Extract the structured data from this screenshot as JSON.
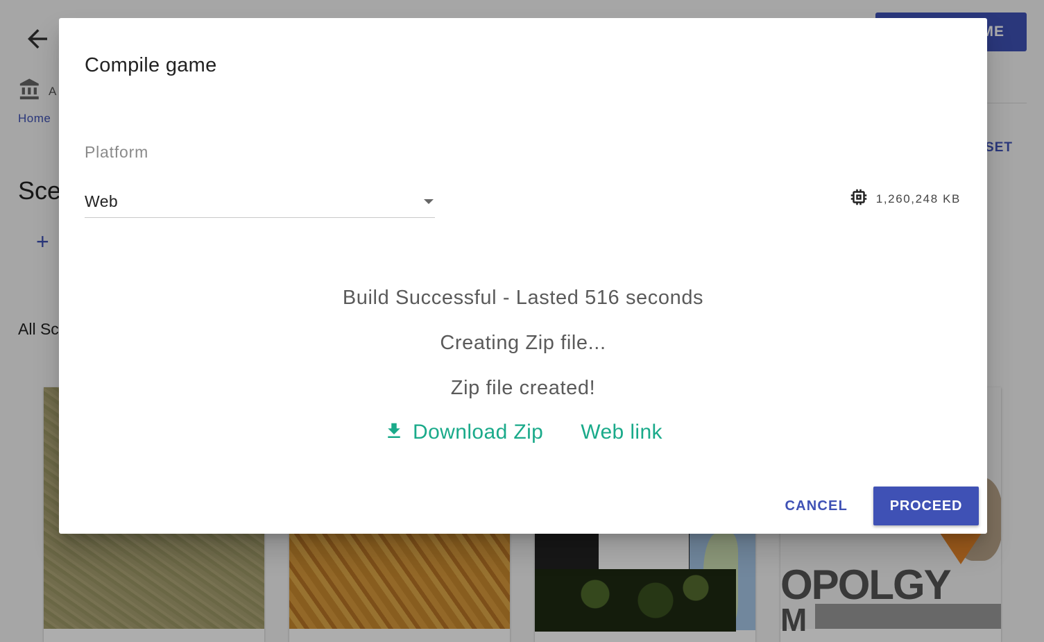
{
  "background": {
    "top_action_label": "ME",
    "project_label": "A",
    "breadcrumb": "Home",
    "reset_label": "SET",
    "section_title": "Sce",
    "add_label": "+",
    "all_label": "All Sc",
    "cards": [
      {
        "icon": "grass-texture-thumbnail"
      },
      {
        "icon": "wood-texture-thumbnail"
      },
      {
        "icon": "collage-thumbnail"
      },
      {
        "icon": "museum-poster-thumbnail",
        "text_line1": "OPOLGY",
        "text_line2": "M"
      }
    ]
  },
  "dialog": {
    "title": "Compile game",
    "platform_label": "Platform",
    "platform_value": "Web",
    "size_icon": "memory-chip-icon",
    "size_text": "1,260,248 KB",
    "status_lines": [
      "Build Successful - Lasted 516 seconds",
      "Creating Zip file...",
      "Zip file created!"
    ],
    "download_label": "Download Zip",
    "weblink_label": "Web link",
    "cancel_label": "CANCEL",
    "proceed_label": "PROCEED"
  },
  "colors": {
    "primary": "#3f51b5",
    "link_green": "#1aaa8a",
    "overlay": "rgba(0,0,0,0.32)"
  }
}
